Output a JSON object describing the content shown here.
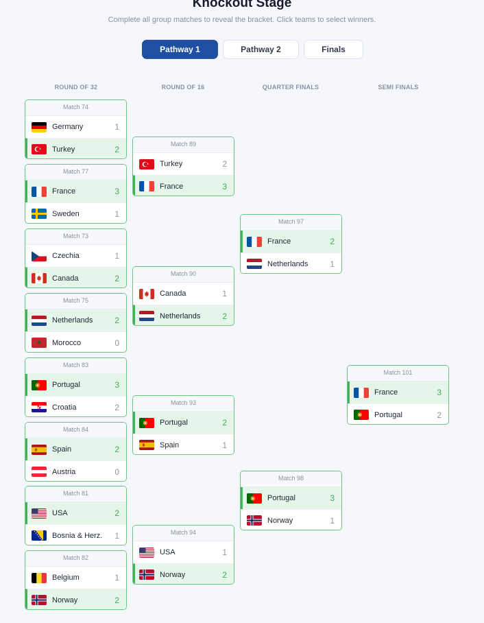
{
  "header": {
    "title": "Knockout Stage",
    "subtitle": "Complete all group matches to reveal the bracket. Click teams to select winners."
  },
  "tabs": [
    {
      "label": "Pathway 1",
      "active": true
    },
    {
      "label": "Pathway 2",
      "active": false
    },
    {
      "label": "Finals",
      "active": false
    }
  ],
  "rounds": [
    "ROUND OF 32",
    "ROUND OF 16",
    "QUARTER FINALS",
    "SEMI FINALS"
  ],
  "colors": {
    "accent": "#1f4fa3",
    "winner_bg": "#e6f5e9",
    "winner_bar": "#43b35c",
    "match_border": "#6cc57f",
    "page_bg": "#f6f7fc"
  },
  "matches": [
    {
      "label": "Match 74",
      "teams": [
        {
          "name": "Germany",
          "flag": "germany-flag",
          "score": "1",
          "winner": false
        },
        {
          "name": "Turkey",
          "flag": "turkey-flag",
          "score": "2",
          "winner": true
        }
      ]
    },
    {
      "label": "Match 77",
      "teams": [
        {
          "name": "France",
          "flag": "france-flag",
          "score": "3",
          "winner": true
        },
        {
          "name": "Sweden",
          "flag": "sweden-flag",
          "score": "1",
          "winner": false
        }
      ]
    },
    {
      "label": "Match 73",
      "teams": [
        {
          "name": "Czechia",
          "flag": "czechia-flag",
          "score": "1",
          "winner": false
        },
        {
          "name": "Canada",
          "flag": "canada-flag",
          "score": "2",
          "winner": true
        }
      ]
    },
    {
      "label": "Match 75",
      "teams": [
        {
          "name": "Netherlands",
          "flag": "netherlands-flag",
          "score": "2",
          "winner": true
        },
        {
          "name": "Morocco",
          "flag": "morocco-flag",
          "score": "0",
          "winner": false
        }
      ]
    },
    {
      "label": "Match 83",
      "teams": [
        {
          "name": "Portugal",
          "flag": "portugal-flag",
          "score": "3",
          "winner": true
        },
        {
          "name": "Croatia",
          "flag": "croatia-flag",
          "score": "2",
          "winner": false
        }
      ]
    },
    {
      "label": "Match 84",
      "teams": [
        {
          "name": "Spain",
          "flag": "spain-flag",
          "score": "2",
          "winner": true
        },
        {
          "name": "Austria",
          "flag": "austria-flag",
          "score": "0",
          "winner": false
        }
      ]
    },
    {
      "label": "Match 81",
      "teams": [
        {
          "name": "USA",
          "flag": "usa-flag",
          "score": "2",
          "winner": true
        },
        {
          "name": "Bosnia & Herz.",
          "flag": "bosnia-flag",
          "score": "1",
          "winner": false
        }
      ]
    },
    {
      "label": "Match 82",
      "teams": [
        {
          "name": "Belgium",
          "flag": "belgium-flag",
          "score": "1",
          "winner": false
        },
        {
          "name": "Norway",
          "flag": "norway-flag",
          "score": "2",
          "winner": true
        }
      ]
    },
    {
      "label": "Match 89",
      "teams": [
        {
          "name": "Turkey",
          "flag": "turkey-flag",
          "score": "2",
          "winner": false
        },
        {
          "name": "France",
          "flag": "france-flag",
          "score": "3",
          "winner": true
        }
      ]
    },
    {
      "label": "Match 90",
      "teams": [
        {
          "name": "Canada",
          "flag": "canada-flag",
          "score": "1",
          "winner": false
        },
        {
          "name": "Netherlands",
          "flag": "netherlands-flag",
          "score": "2",
          "winner": true
        }
      ]
    },
    {
      "label": "Match 93",
      "teams": [
        {
          "name": "Portugal",
          "flag": "portugal-flag",
          "score": "2",
          "winner": true
        },
        {
          "name": "Spain",
          "flag": "spain-flag",
          "score": "1",
          "winner": false
        }
      ]
    },
    {
      "label": "Match 94",
      "teams": [
        {
          "name": "USA",
          "flag": "usa-flag",
          "score": "1",
          "winner": false
        },
        {
          "name": "Norway",
          "flag": "norway-flag",
          "score": "2",
          "winner": true
        }
      ]
    },
    {
      "label": "Match 97",
      "teams": [
        {
          "name": "France",
          "flag": "france-flag",
          "score": "2",
          "winner": true
        },
        {
          "name": "Netherlands",
          "flag": "netherlands-flag",
          "score": "1",
          "winner": false
        }
      ]
    },
    {
      "label": "Match 98",
      "teams": [
        {
          "name": "Portugal",
          "flag": "portugal-flag",
          "score": "3",
          "winner": true
        },
        {
          "name": "Norway",
          "flag": "norway-flag",
          "score": "1",
          "winner": false
        }
      ]
    },
    {
      "label": "Match 101",
      "teams": [
        {
          "name": "France",
          "flag": "france-flag",
          "score": "3",
          "winner": true
        },
        {
          "name": "Portugal",
          "flag": "portugal-flag",
          "score": "2",
          "winner": false
        }
      ]
    }
  ]
}
